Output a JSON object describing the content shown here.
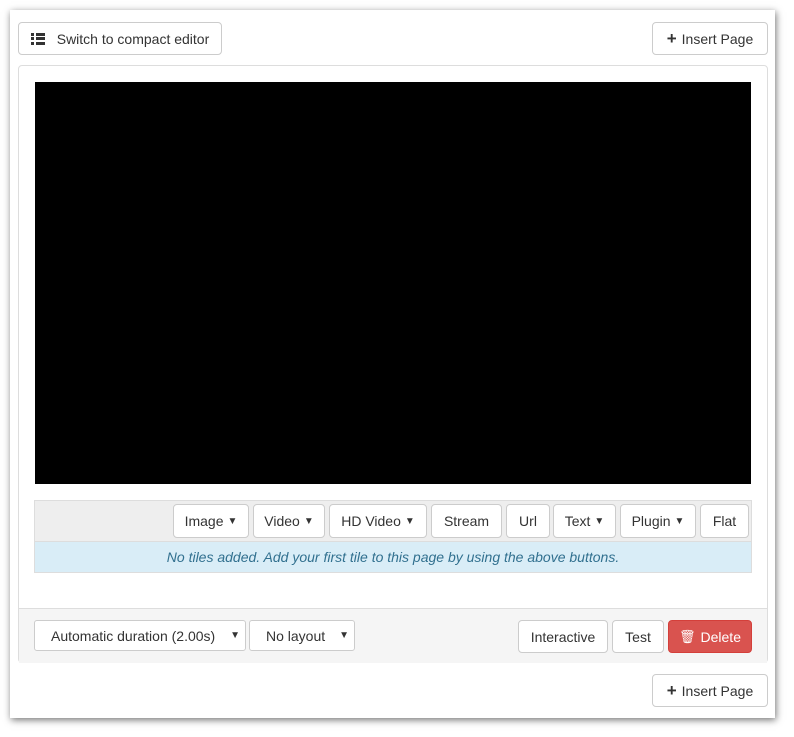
{
  "toolbar": {
    "compact_editor_label": "Switch to compact editor",
    "compact_editor_icon": "list-icon",
    "insert_page_label": "Insert Page",
    "insert_page_icon": "plus-icon"
  },
  "tile_buttons": [
    {
      "label": "Image",
      "dropdown": true
    },
    {
      "label": "Video",
      "dropdown": true
    },
    {
      "label": "HD Video",
      "dropdown": true
    },
    {
      "label": "Stream",
      "dropdown": false
    },
    {
      "label": "Url",
      "dropdown": false
    },
    {
      "label": "Text",
      "dropdown": true
    },
    {
      "label": "Plugin",
      "dropdown": true
    },
    {
      "label": "Flat",
      "dropdown": false
    }
  ],
  "tiles_empty_message": "No tiles added. Add your first tile to this page by using the above buttons.",
  "footer": {
    "duration_select": "Automatic duration (2.00s)",
    "layout_select": "No layout",
    "interactive_label": "Interactive",
    "test_label": "Test",
    "delete_label": "Delete",
    "delete_icon": "trash-icon",
    "delete_color": "#d9534f"
  },
  "bottom": {
    "insert_page_label": "Insert Page"
  }
}
